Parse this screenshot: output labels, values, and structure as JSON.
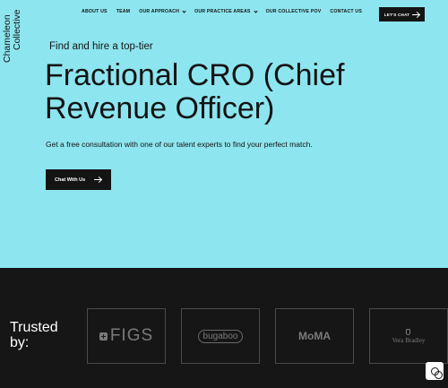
{
  "brand": {
    "line1": "Chameleon",
    "line2": "Collective"
  },
  "nav": {
    "items": [
      {
        "label": "ABOUT US",
        "dropdown": false
      },
      {
        "label": "TEAM",
        "dropdown": false
      },
      {
        "label": "OUR APPROACH",
        "dropdown": true
      },
      {
        "label": "OUR PRACTICE AREAS",
        "dropdown": true
      },
      {
        "label": "OUR COLLECTIVE POV",
        "dropdown": false
      },
      {
        "label": "CONTACT US",
        "dropdown": false
      }
    ],
    "cta": "LET'S CHAT"
  },
  "hero": {
    "kicker": "Find and hire a top-tier",
    "headline": "Fractional CRO (Chief Revenue Officer)",
    "subtext": "Get a free consultation with one of our talent experts to find your perfect match.",
    "button": "Chat With Us"
  },
  "trusted": {
    "label": "Trusted by:",
    "logos": [
      {
        "name": "FIGS"
      },
      {
        "name": "bugaboo"
      },
      {
        "name": "MoMA"
      },
      {
        "name": "Vera Bradley"
      }
    ]
  },
  "colors": {
    "hero_bg": "#8de5ef",
    "dark": "#161616",
    "text": "#141414"
  }
}
